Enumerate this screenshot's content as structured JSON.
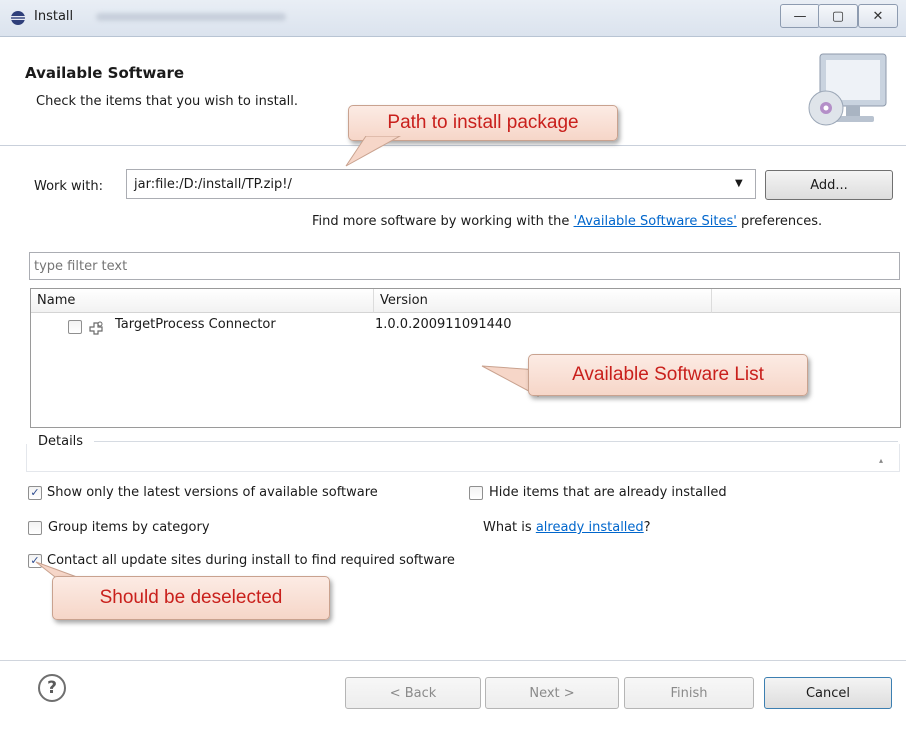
{
  "window": {
    "title": "Install",
    "title_suffix_blurred": "",
    "controls": {
      "minimize": "—",
      "maximize": "▢",
      "close": "✕"
    }
  },
  "header": {
    "title": "Available Software",
    "subtitle": "Check the items that you wish to install."
  },
  "annotations": {
    "path": "Path to install package",
    "list": "Available Software List",
    "deselect": "Should be deselected"
  },
  "work_with": {
    "label": "Work with:",
    "value": "jar:file:/D:/install/TP.zip!/",
    "add_button": "Add..."
  },
  "find_more": {
    "prefix": "Find more software by working with the",
    "link": "'Available Software Sites'",
    "suffix": "preferences."
  },
  "filter": {
    "placeholder": "type filter text"
  },
  "table": {
    "columns": [
      "Name",
      "Version"
    ],
    "rows": [
      {
        "name": "TargetProcess Connector",
        "version": "1.0.0.200911091440",
        "checked": false
      }
    ]
  },
  "details": {
    "label": "Details"
  },
  "options": {
    "latest_only": {
      "label": "Show only the latest versions of available software",
      "checked": true
    },
    "hide_installed": {
      "label": "Hide items that are already installed",
      "checked": false
    },
    "group_by_category": {
      "label": "Group items by category",
      "checked": false
    },
    "what_is_prefix": "What is",
    "what_is_link": "already installed",
    "what_is_suffix": "?",
    "contact_all": {
      "label": "Contact all update sites during install to find required software",
      "checked": true
    }
  },
  "footer": {
    "help_icon": "?",
    "back": "< Back",
    "next": "Next >",
    "finish": "Finish",
    "cancel": "Cancel"
  },
  "colors": {
    "accent_link": "#0066cc",
    "annotation_text": "#c9201c",
    "annotation_bg": "#f6d6c8"
  }
}
